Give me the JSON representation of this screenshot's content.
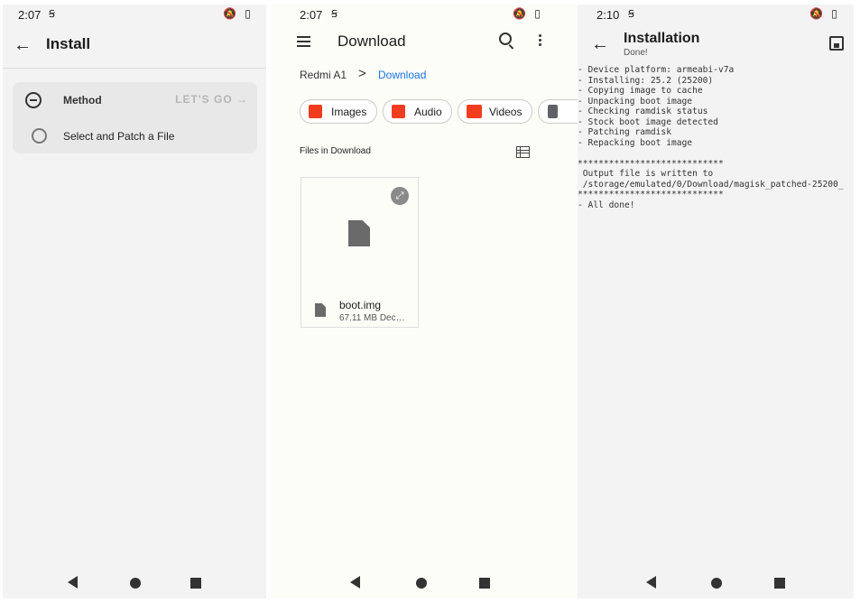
{
  "panel_install": {
    "status_time": "2:07",
    "status_icons": "🔕 ▯",
    "title": "Install",
    "method_label": "Method",
    "lets_go": "LET'S GO →",
    "option": "Select and Patch a File"
  },
  "panel_download": {
    "status_time": "2:07",
    "status_icons": "🔕 ▯",
    "title": "Download",
    "breadcrumb_root": "Redmi A1",
    "breadcrumb_sep": ">",
    "breadcrumb_current": "Download",
    "chips": [
      {
        "label": "Images",
        "icon": "image-icon",
        "color": "#f23c1f"
      },
      {
        "label": "Audio",
        "icon": "headphones-icon",
        "color": "#f23c1f"
      },
      {
        "label": "Videos",
        "icon": "film-icon",
        "color": "#f23c1f"
      },
      {
        "label": "",
        "icon": "document-icon",
        "color": "#5f6368"
      }
    ],
    "section_label": "Files in Download",
    "file": {
      "name": "boot.img",
      "meta": "67.11 MB Dec…"
    }
  },
  "panel_installation": {
    "status_time": "2:10",
    "status_icons": "🔕 ▯",
    "title": "Installation",
    "subtitle": "Done!",
    "console_lines": [
      "- Device platform: armeabi-v7a",
      "- Installing: 25.2 (25200)",
      "- Copying image to cache",
      "- Unpacking boot image",
      "- Checking ramdisk status",
      "- Stock boot image detected",
      "- Patching ramdisk",
      "- Repacking boot image",
      "",
      "****************************",
      " Output file is written to",
      " /storage/emulated/0/Download/magisk_patched-25200_",
      "****************************",
      "- All done!"
    ]
  },
  "colors": {
    "accent_link": "#1a73e8",
    "chip_icon": "#f23c1f"
  }
}
